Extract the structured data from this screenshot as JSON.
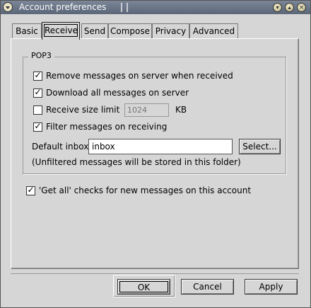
{
  "window": {
    "title": "Account preferences"
  },
  "tabs": [
    {
      "label": "Basic"
    },
    {
      "label": "Receive"
    },
    {
      "label": "Send"
    },
    {
      "label": "Compose"
    },
    {
      "label": "Privacy"
    },
    {
      "label": "Advanced"
    }
  ],
  "active_tab": "Receive",
  "pop3": {
    "group_title": "POP3",
    "remove_on_server": {
      "label": "Remove messages on server when received",
      "checked": true
    },
    "download_all": {
      "label": "Download all messages on server",
      "checked": true
    },
    "size_limit": {
      "label": "Receive size limit",
      "checked": false,
      "value": "1024",
      "unit": "KB"
    },
    "filter_on_receive": {
      "label": "Filter messages on receiving",
      "checked": true
    },
    "default_inbox": {
      "label": "Default inbox",
      "value": "inbox",
      "select_label": "Select..."
    },
    "note": "(Unfiltered messages will be stored in this folder)"
  },
  "get_all": {
    "label": "'Get all' checks for new messages on this account",
    "checked": true
  },
  "buttons": {
    "ok": "OK",
    "cancel": "Cancel",
    "apply": "Apply"
  }
}
